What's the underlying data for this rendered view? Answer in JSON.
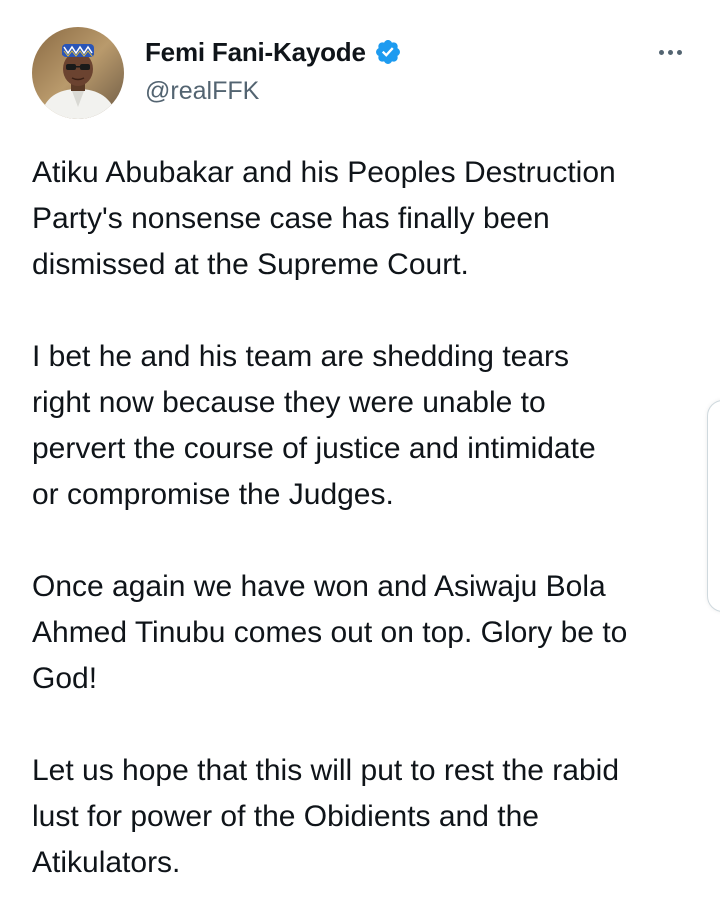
{
  "author": {
    "display_name": "Femi Fani-Kayode",
    "handle": "@realFFK",
    "verified": true
  },
  "icons": {
    "verified": "verified-badge-icon",
    "more": "more-options-icon"
  },
  "colors": {
    "verified_blue": "#1d9bf0",
    "text_primary": "#0f1419",
    "text_secondary": "#536471"
  },
  "tweet": {
    "paragraphs": [
      "Atiku Abubakar and his Peoples Destruction\nParty's nonsense case has finally been\ndismissed at the Supreme Court.",
      "I bet he and his team are shedding tears\nright now because they were unable to\npervert the course of justice and intimidate\nor compromise the Judges.",
      "Once again we have won and Asiwaju Bola\nAhmed Tinubu comes out on top. Glory be to\nGod!",
      "Let us hope that this will put to rest the rabid\nlust for power of the Obidients and the\nAtikulators."
    ]
  }
}
